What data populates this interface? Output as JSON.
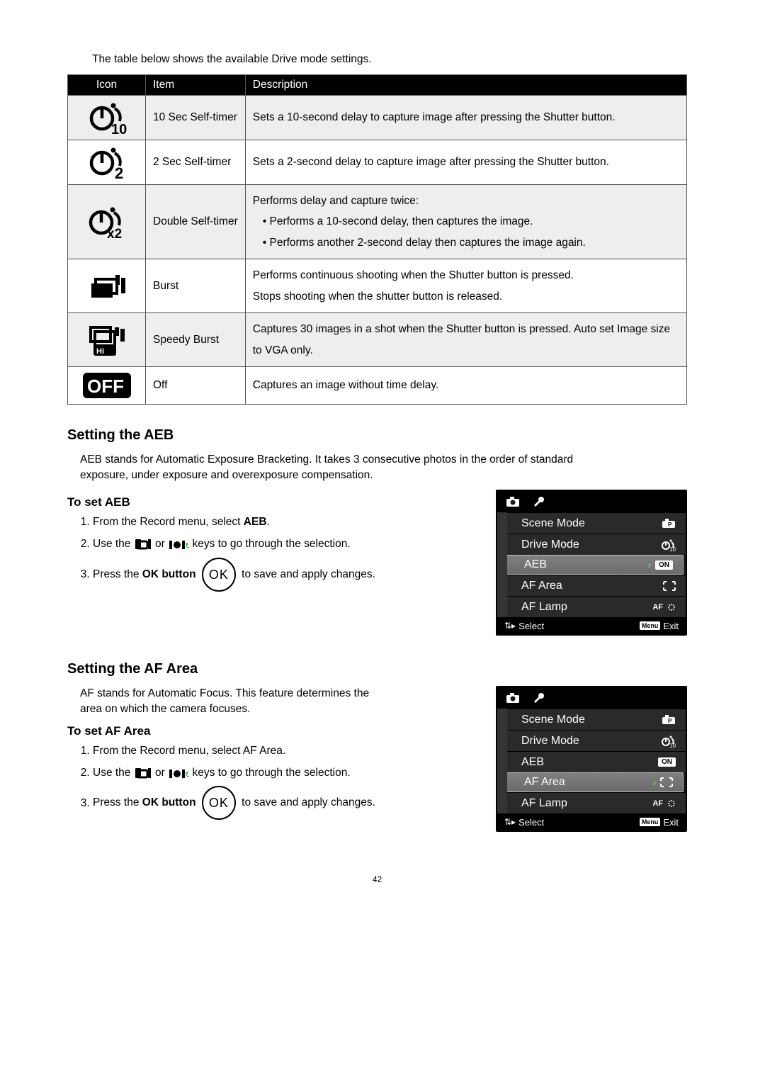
{
  "intro": "The table below shows the available Drive mode settings.",
  "table": {
    "headers": [
      "Icon",
      "Item",
      "Description"
    ],
    "rows": [
      {
        "item": "10 Sec Self-timer",
        "desc": "Sets a 10-second delay to capture image after pressing the Shutter button."
      },
      {
        "item": "2 Sec Self-timer",
        "desc": "Sets a 2-second delay to capture image after pressing the Shutter button."
      },
      {
        "item": "Double Self-timer",
        "desc_lead": "Performs delay and capture twice:",
        "desc_b1": "Performs a 10-second delay, then captures the image.",
        "desc_b2": "Performs another 2-second delay then captures the image again."
      },
      {
        "item": "Burst",
        "desc_l1": "Performs continuous shooting when the Shutter button is pressed.",
        "desc_l2": "Stops shooting when the shutter button is released."
      },
      {
        "item": "Speedy Burst",
        "desc": "Captures 30 images in a shot when the Shutter button is pressed. Auto set Image size to VGA only."
      },
      {
        "item": "Off",
        "desc": "Captures an image without time delay."
      }
    ]
  },
  "sections": {
    "aeb": {
      "heading": "Setting the AEB",
      "para": "AEB stands for Automatic Exposure Bracketing. It takes 3 consecutive photos in the order of standard exposure, under exposure and overexposure compensation.",
      "sub": "To set AEB",
      "steps": {
        "s1a": "From the Record menu, select ",
        "s1b": "AEB",
        "s1c": ".",
        "s2a": "Use the ",
        "s2b": " or ",
        "s2c": " keys to go through the selection.",
        "s3a": "Press the ",
        "s3b": "OK button",
        "s3c": " to save and apply changes.",
        "ok": "OK"
      }
    },
    "af": {
      "heading": "Setting the AF Area",
      "para": "AF stands for Automatic Focus. This feature determines the area on which the camera focuses.",
      "sub": "To set AF Area",
      "steps": {
        "s1": "From the Record menu, select AF Area.",
        "s2a": "Use the ",
        "s2b": " or ",
        "s2c": " keys to go through the selection.",
        "s3a": "Press the ",
        "s3b": "OK button",
        "s3c": " to save and apply changes.",
        "ok": "OK"
      }
    }
  },
  "menu": {
    "rows": {
      "scene": "Scene Mode",
      "drive": "Drive Mode",
      "aeb": "AEB",
      "afarea": "AF Area",
      "aflamp": "AF Lamp"
    },
    "vals": {
      "on": "ON",
      "p": "P",
      "af": "AF"
    },
    "foot": {
      "select": "Select",
      "menu": "Menu",
      "exit": "Exit"
    }
  },
  "page": "42"
}
